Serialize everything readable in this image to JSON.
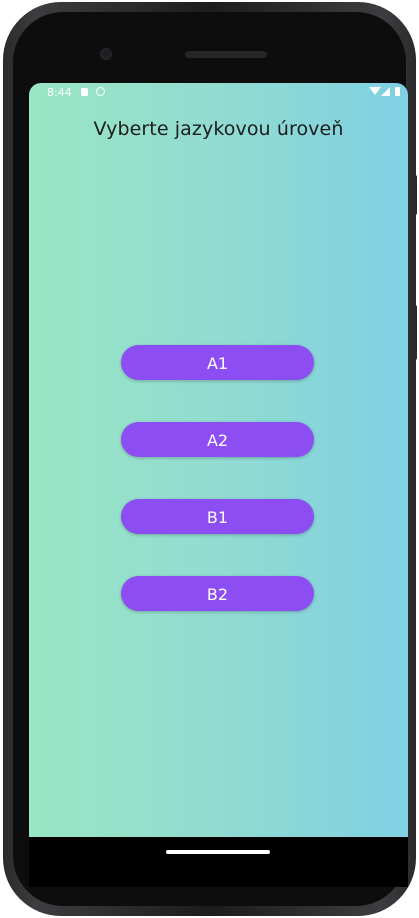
{
  "status_bar": {
    "time": "8:44",
    "icons": [
      "sd-card-icon",
      "sync-circle-icon",
      "wifi-icon",
      "signal-icon",
      "battery-icon"
    ]
  },
  "screen": {
    "title": "Vyberte jazykovou úroveň",
    "background_gradient": [
      "#99e6c4",
      "#7fd1e3"
    ]
  },
  "level_buttons": [
    {
      "label": "A1"
    },
    {
      "label": "A2"
    },
    {
      "label": "B1"
    },
    {
      "label": "B2"
    }
  ],
  "colors": {
    "button": "#8c4ef3",
    "button_text": "#ffffff",
    "title_text": "#1d1d1d"
  }
}
